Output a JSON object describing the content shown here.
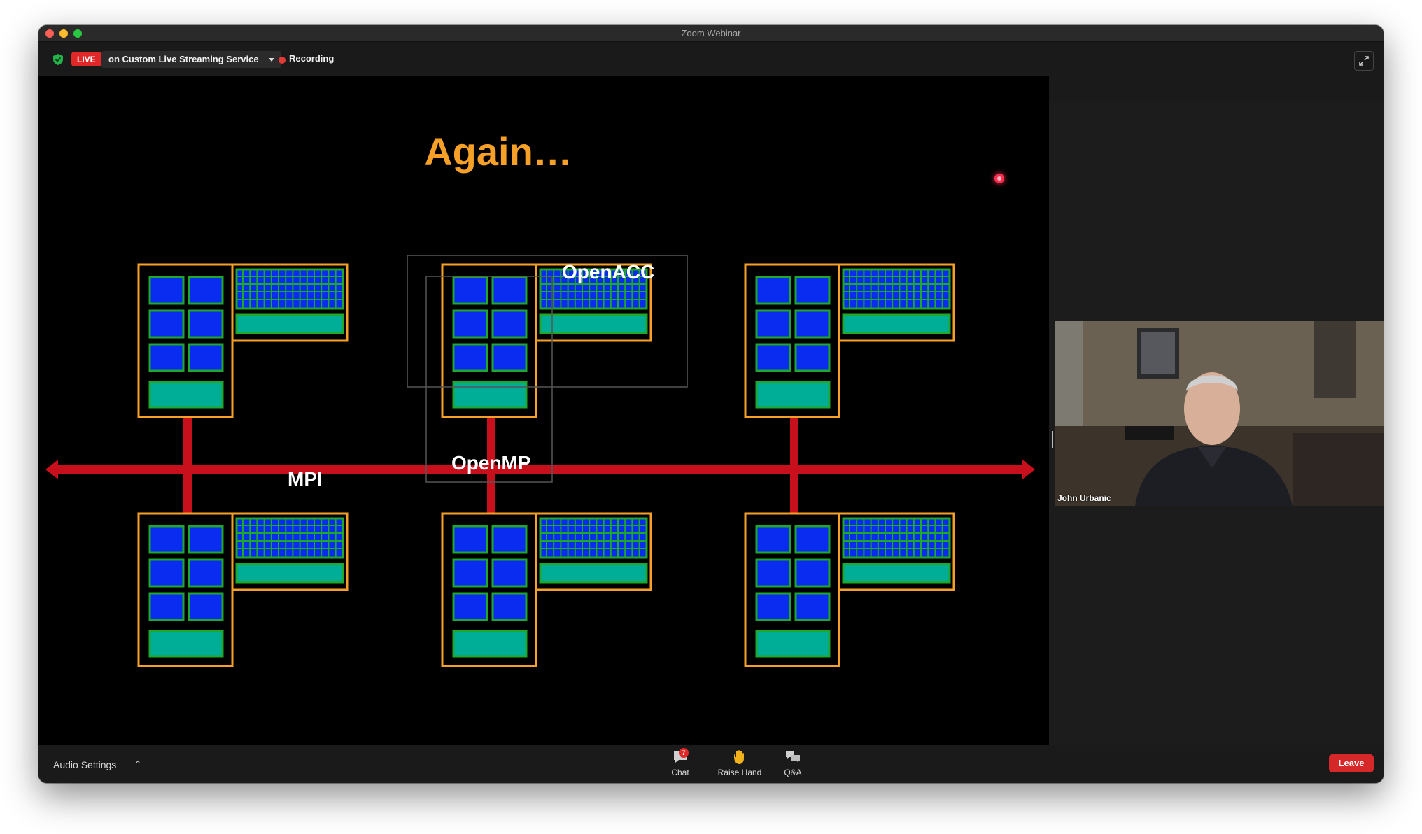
{
  "window": {
    "title": "Zoom Webinar"
  },
  "topbar": {
    "live_label": "LIVE",
    "stream_service": "on Custom Live Streaming Service",
    "recording_label": "Recording"
  },
  "slide": {
    "title": "Again…",
    "labels": {
      "openacc": "OpenACC",
      "openmp": "OpenMP",
      "mpi": "MPI"
    },
    "colors": {
      "node_border": "#f6a027",
      "core": "#0a2cf0",
      "core_border": "#1fa82a",
      "memory": "#00ad96",
      "interconnect": "#c8101c"
    }
  },
  "participant": {
    "name": "John Urbanic"
  },
  "toolbar": {
    "audio_settings": "Audio Settings",
    "chat_label": "Chat",
    "chat_count": "7",
    "raise_hand_label": "Raise Hand",
    "qa_label": "Q&A",
    "leave_label": "Leave"
  },
  "icons": [
    "shield-icon",
    "caret-down-icon",
    "recording-dot-icon",
    "fullscreen-icon",
    "chat-icon",
    "raise-hand-icon",
    "qa-icon",
    "caret-up-icon"
  ]
}
